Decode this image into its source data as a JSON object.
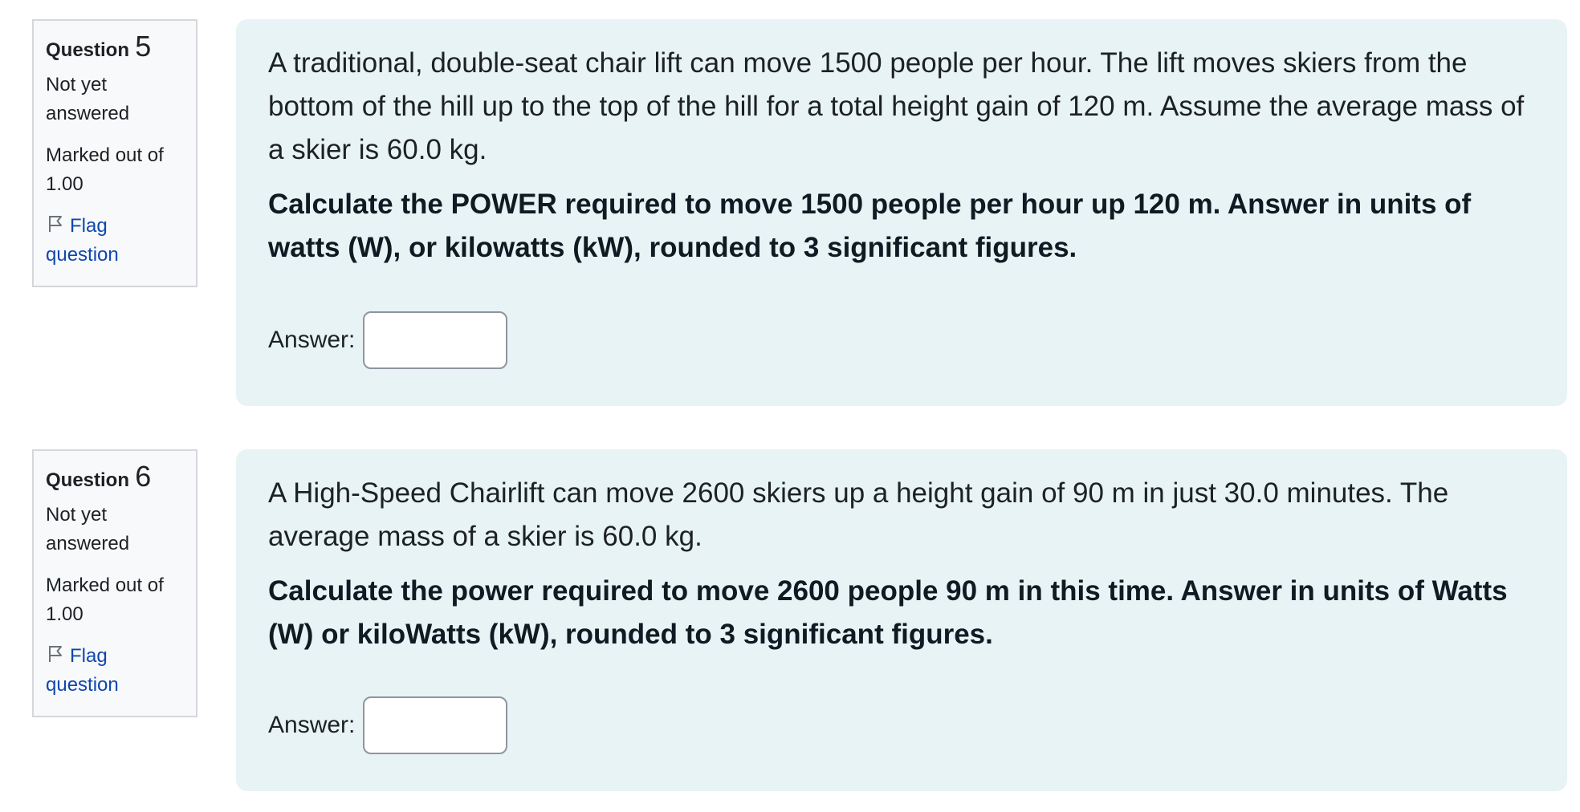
{
  "questions": [
    {
      "label_word": "Question",
      "number": "5",
      "state": "Not yet answered",
      "grade": "Marked out of 1.00",
      "flag_label": "Flag question",
      "text": "A traditional, double-seat chair lift can move 1500 people per hour.  The lift moves skiers from the bottom of the hill up to the top of the hill for a total height gain of 120 m.  Assume the average mass of a skier is 60.0 kg.",
      "prompt": "Calculate the POWER required to move 1500 people per hour up 120 m.  Answer in units of watts (W), or kilowatts (kW), rounded to 3 significant figures.",
      "answer_label": "Answer:",
      "answer_value": ""
    },
    {
      "label_word": "Question",
      "number": "6",
      "state": "Not yet answered",
      "grade": "Marked out of 1.00",
      "flag_label": "Flag question",
      "text": "A High-Speed Chairlift can move 2600 skiers up a height gain of 90 m in just 30.0 minutes.  The average mass of a skier is 60.0 kg.",
      "prompt": "Calculate the power required to move 2600 people 90 m in this time.  Answer in units of Watts (W) or kiloWatts (kW), rounded to 3 significant figures.",
      "answer_label": "Answer:",
      "answer_value": ""
    }
  ],
  "colors": {
    "info_bg": "#f8f9fa",
    "content_bg": "#e7f3f5",
    "link": "#0f47ad"
  },
  "icons": {
    "flag": "flag-icon"
  }
}
